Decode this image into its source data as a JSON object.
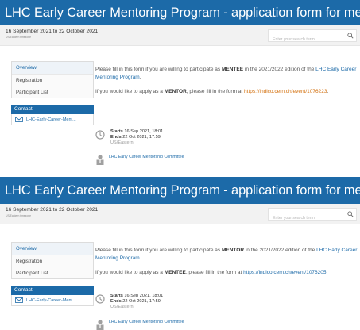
{
  "events": [
    {
      "title": "LHC Early Career Mentoring Program - application form for mentees",
      "dates": "16 September 2021 to 22 October 2021",
      "timezone": "US/Eastern timezone",
      "search_placeholder": "Enter your search term",
      "menu": [
        "Overview",
        "Registration",
        "Participant List"
      ],
      "contact_label": "Contact",
      "contact_email": "LHC-Early-Career-Ment...",
      "para1": {
        "prefix": "Please fill in this form if you are willing to participate as ",
        "role": "MENTEE",
        "middle": " in the 2021/2022 edition of the ",
        "link": "LHC Early Career Mentoring Program",
        "suffix": "."
      },
      "para2": {
        "prefix": "If you would like to apply as a ",
        "role": "MENTOR",
        "middle": ", please fill in the form at ",
        "link": "https://indico.cern.ch/event/1076223",
        "suffix": "."
      },
      "starts_label": "Starts",
      "starts": "16 Sep 2021, 18:01",
      "ends_label": "Ends",
      "ends": "22 Oct 2021, 17:59",
      "tz_short": "US/Eastern",
      "chair": "LHC Early Career Mentorship Committee"
    },
    {
      "title": "LHC Early Career Mentoring Program - application form for mentors",
      "dates": "16 September 2021 to 22 October 2021",
      "timezone": "US/Eastern timezone",
      "search_placeholder": "Enter your search term",
      "menu": [
        "Overview",
        "Registration",
        "Participant List"
      ],
      "contact_label": "Contact",
      "contact_email": "LHC-Early-Career-Ment...",
      "para1": {
        "prefix": "Please fill in this form if you are willing to participate as ",
        "role": "MENTOR",
        "middle": " in the 2021/2022 edition of the ",
        "link": "LHC Early Career Mentoring Program",
        "suffix": "."
      },
      "para2": {
        "prefix": "If you would like to apply as a ",
        "role": "MENTEE",
        "middle": ", please fill in the form at ",
        "link": "https://indico.cern.ch/event/1076205",
        "suffix": "."
      },
      "starts_label": "Starts",
      "starts": "16 Sep 2021, 18:01",
      "ends_label": "Ends",
      "ends": "22 Oct 2021, 17:59",
      "tz_short": "US/Eastern",
      "chair": "LHC Early Career Mentorship Committee"
    }
  ],
  "colors": {
    "header": "#1c6aa8",
    "link": "#1c6aa8",
    "link_alt": "#d3700e"
  },
  "icons": [
    "search-icon",
    "envelope-icon",
    "clock-icon",
    "person-icon"
  ]
}
